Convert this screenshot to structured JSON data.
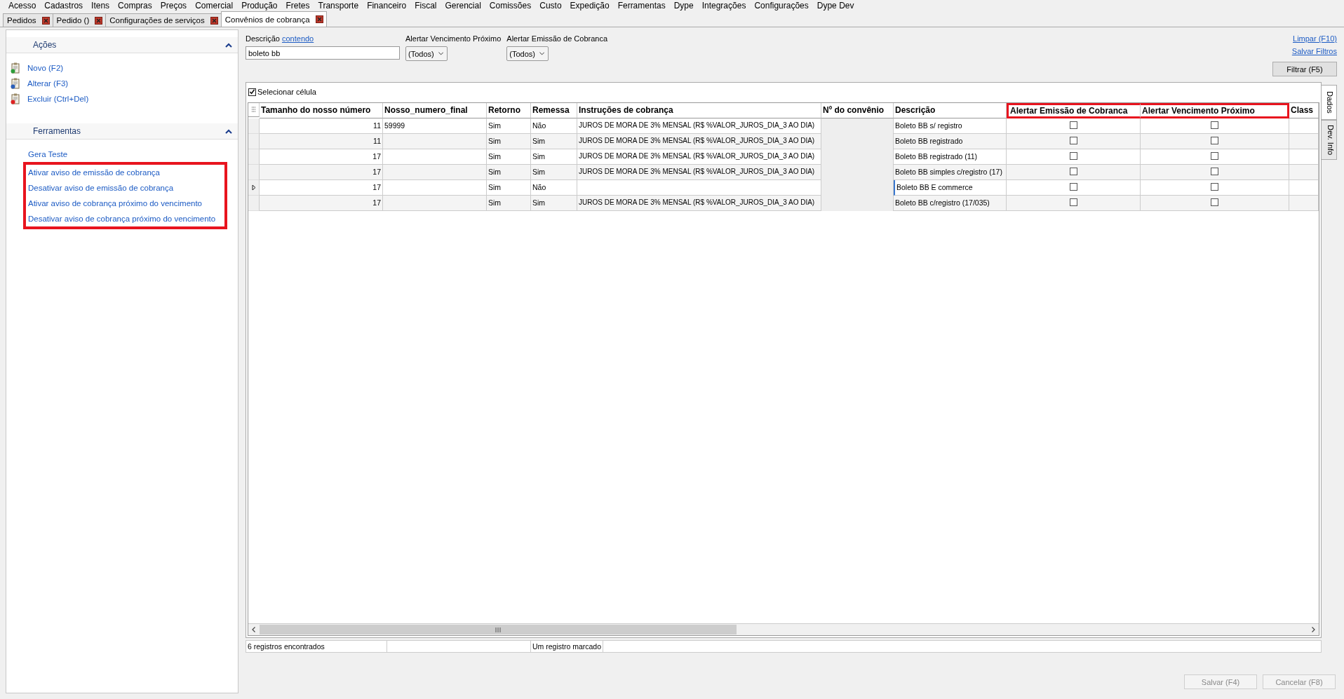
{
  "menu": [
    "Acesso",
    "Cadastros",
    "Itens",
    "Compras",
    "Preços",
    "Comercial",
    "Produção",
    "Fretes",
    "Transporte",
    "Financeiro",
    "Fiscal",
    "Gerencial",
    "Comissões",
    "Custo",
    "Expedição",
    "Ferramentas",
    "Dype",
    "Integrações",
    "Configurações",
    "Dype Dev"
  ],
  "tabs": [
    {
      "label": "Pedidos",
      "selected": false
    },
    {
      "label": "Pedido ()",
      "selected": false
    },
    {
      "label": "Configurações de serviços",
      "selected": false
    },
    {
      "label": "Convênios de cobrança",
      "selected": true
    }
  ],
  "sidebar": {
    "sections": [
      {
        "title": "Ações",
        "expanded": true,
        "items": [
          {
            "label": "Novo (F2)",
            "kind": "new"
          },
          {
            "label": "Alterar (F3)",
            "kind": "edit"
          },
          {
            "label": "Excluir (Ctrl+Del)",
            "kind": "delete"
          }
        ]
      },
      {
        "title": "Ferramentas",
        "expanded": true,
        "items": [
          {
            "label": "Gera Teste",
            "kind": "plain"
          },
          {
            "label": "Ativar aviso de emissão de cobrança",
            "kind": "highlighted"
          },
          {
            "label": "Desativar aviso de emissão de cobrança",
            "kind": "highlighted"
          },
          {
            "label": "Ativar aviso de cobrança próximo do vencimento",
            "kind": "highlighted"
          },
          {
            "label": "Desativar aviso de cobrança próximo do vencimento",
            "kind": "highlighted"
          }
        ]
      }
    ]
  },
  "filters": {
    "description_label": "Descrição",
    "description_mode": "contendo",
    "description_value": "boleto bb",
    "selects": [
      {
        "label": "Alertar Vencimento Próximo",
        "value": "(Todos)"
      },
      {
        "label": "Alertar Emissão de Cobranca",
        "value": "(Todos)"
      }
    ],
    "links": [
      "Limpar (F10)",
      "Salvar Filtros"
    ],
    "filter_button": "Filtrar (F5)"
  },
  "grid": {
    "select_cell": {
      "label": "Selecionar célula",
      "checked": true
    },
    "columns": [
      {
        "label": "Tamanho do nosso número",
        "highlighted": false
      },
      {
        "label": "Nosso_numero_final",
        "highlighted": false
      },
      {
        "label": "Retorno",
        "highlighted": false
      },
      {
        "label": "Remessa",
        "highlighted": false
      },
      {
        "label": "Instruções de cobrança",
        "highlighted": false
      },
      {
        "label": "Nº do convênio",
        "highlighted": false
      },
      {
        "label": "Descrição",
        "highlighted": false
      },
      {
        "label": "Alertar Emissão de Cobranca",
        "highlighted": true
      },
      {
        "label": "Alertar Vencimento Próximo",
        "highlighted": true
      },
      {
        "label": "Class",
        "highlighted": false
      }
    ],
    "rows": [
      {
        "current": false,
        "tamanho": "11",
        "nosso_numero_final": "59999",
        "retorno": "Sim",
        "remessa": "Não",
        "instrucoes": "JUROS DE MORA DE 3% MENSAL (R$ %VALOR_JUROS_DIA_3 AO DIA)",
        "descricao": "Boleto BB s/ registro",
        "alertar_emissao": false,
        "alertar_vencimento": false
      },
      {
        "current": false,
        "tamanho": "11",
        "retorno": "Sim",
        "remessa": "Sim",
        "instrucoes": "JUROS DE MORA DE 3% MENSAL (R$ %VALOR_JUROS_DIA_3 AO DIA)",
        "descricao": "Boleto BB registrado",
        "alertar_emissao": false,
        "alertar_vencimento": false
      },
      {
        "current": false,
        "tamanho": "17",
        "retorno": "Sim",
        "remessa": "Sim",
        "instrucoes": "JUROS DE MORA DE 3% MENSAL (R$ %VALOR_JUROS_DIA_3 AO DIA)",
        "descricao": "Boleto BB registrado (11)",
        "alertar_emissao": false,
        "alertar_vencimento": false
      },
      {
        "current": false,
        "tamanho": "17",
        "retorno": "Sim",
        "remessa": "Sim",
        "instrucoes": "JUROS DE MORA DE 3% MENSAL (R$ %VALOR_JUROS_DIA_3 AO DIA)",
        "descricao": "Boleto BB simples c/registro (17)",
        "alertar_emissao": false,
        "alertar_vencimento": false
      },
      {
        "current": true,
        "tamanho": "17",
        "retorno": "Sim",
        "remessa": "Não",
        "descricao": "Boleto BB E commerce",
        "alertar_emissao": false,
        "alertar_vencimento": false
      },
      {
        "current": false,
        "tamanho": "17",
        "retorno": "Sim",
        "remessa": "Sim",
        "instrucoes": "JUROS DE MORA DE 3% MENSAL (R$ %VALOR_JUROS_DIA_3 AO DIA)",
        "descricao": "Boleto BB c/registro (17/035)",
        "alertar_emissao": false,
        "alertar_vencimento": false
      }
    ],
    "side_tabs": [
      {
        "label": "Dados",
        "selected": true
      },
      {
        "label": "Dev. Info",
        "selected": false
      }
    ]
  },
  "status_bar": [
    "6 registros encontrados",
    "Um registro marcado"
  ],
  "buttons": [
    {
      "label": "Salvar (F4)",
      "disabled": true
    },
    {
      "label": "Cancelar (F8)",
      "disabled": true
    }
  ]
}
